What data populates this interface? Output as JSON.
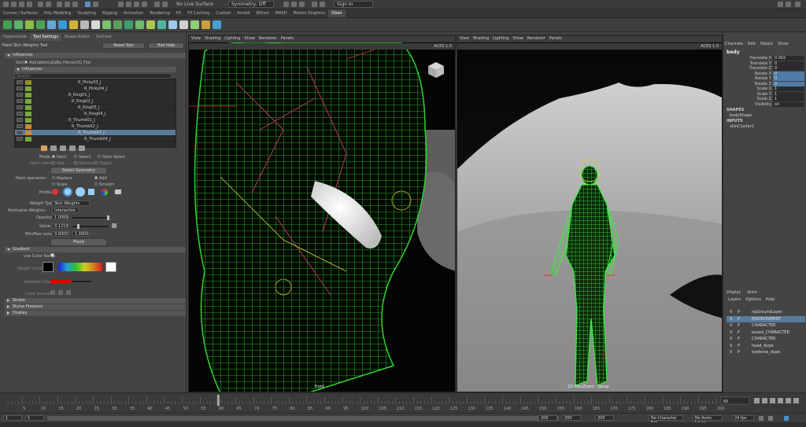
{
  "top": {
    "live_surface": "No Live Surface",
    "symmetry": "Symmetry: Off",
    "sign_in": "Sign In"
  },
  "shelf_tabs": [
    "Curves / Surfaces",
    "Poly Modeling",
    "Sculpting",
    "Rigging",
    "Animation",
    "Rendering",
    "FX",
    "FX Caching",
    "Custom",
    "Arnold",
    "Bifrost",
    "MASH",
    "Motion Graphics",
    "XGen"
  ],
  "shelf_colors": [
    "#3fa34d",
    "#59b36b",
    "#8bbf45",
    "#4aa657",
    "#63a8d6",
    "#3a9ad9",
    "#d6b13a",
    "#b9b9b9",
    "#d9d9d9",
    "#79c36a",
    "#5ba05d",
    "#3f9d6b",
    "#6db86b",
    "#a8c94f",
    "#50b6a1",
    "#9ec9e8",
    "#d0d0d0",
    "#8fcf75",
    "#c7a03a",
    "#46a0d6"
  ],
  "left_panel": {
    "tabs": [
      "Hypershade",
      "Tool Settings",
      "Shape Editor",
      "Outliner"
    ],
    "tool_name": "Paint Skin Weights Tool",
    "reset_tool": "Reset Tool",
    "tool_help": "Tool Help",
    "influences_header": "Influences",
    "sort_label": "Sort:",
    "sort_options": [
      "Alphabetically",
      "By Hierarchy",
      "Flat"
    ],
    "influences_subheader": "Influences",
    "search_placeholder": "Search",
    "joints": [
      {
        "name": "R_Pinky03_J",
        "color": "#8f8f2a",
        "indent": 80
      },
      {
        "name": "R_Pinky04_J",
        "color": "#7aa63c",
        "indent": 88
      },
      {
        "name": "R_Ring01_J",
        "color": "#7aa63c",
        "indent": 68
      },
      {
        "name": "R_Ring02_J",
        "color": "#7aa63c",
        "indent": 72
      },
      {
        "name": "R_Ring03_J",
        "color": "#7aa63c",
        "indent": 80
      },
      {
        "name": "R_Ring04_J",
        "color": "#7aa63c",
        "indent": 88
      },
      {
        "name": "R_Thumb01_J",
        "color": "#7aa63c",
        "indent": 68
      },
      {
        "name": "R_Thumb02_J",
        "color": "#c98a3a",
        "indent": 72
      },
      {
        "name": "R_Thumb03_J",
        "color": "#c98a3a",
        "indent": 80,
        "selected": true
      },
      {
        "name": "R_Thumb04_J",
        "color": "#7aa63c",
        "indent": 88
      }
    ],
    "mode_label": "Mode:",
    "mode_options": [
      "Paint",
      "Select",
      "Paint Select"
    ],
    "paint_select_label": "Paint select:",
    "paint_select_options": [
      "Add",
      "Remove",
      "Toggle"
    ],
    "select_geometry": "Select Geometry",
    "paint_operation_label": "Paint operation:",
    "paint_operation_options": [
      "Replace",
      "Add",
      "Scale",
      "Smooth"
    ],
    "profile_label": "Profile:",
    "weight_type_label": "Weight Type:",
    "weight_type_value": "Skin Weights",
    "normalize_label": "Normalize Weights:",
    "normalize_value": "Interactive",
    "opacity_label": "Opacity:",
    "opacity_value": "1.0000",
    "value_label": "Value:",
    "value_value": "0.1210",
    "minmax_label": "Min/Max value:",
    "min_value": "0.0000",
    "max_value": "1.0000",
    "flood": "Flood",
    "gradient_header": "Gradient",
    "use_color_ramp": "Use Color Ramp",
    "weight_colors_label": "Weight Colors:",
    "selected_color_label": "Selected Color:",
    "color_presets_label": "Color presets:",
    "stroke": "Stroke",
    "stylus_pressure": "Stylus Pressure",
    "display": "Display"
  },
  "viewport_left": {
    "menu": [
      "View",
      "Shading",
      "Lighting",
      "Show",
      "Renderer",
      "Panels"
    ],
    "label": "front",
    "aces": "ACES 1.0"
  },
  "viewport_right": {
    "menu": [
      "View",
      "Shading",
      "Lighting",
      "Show",
      "Renderer",
      "Panels"
    ],
    "label": "2D Pan/Zoom : persp",
    "aces": "ACES 1.0"
  },
  "right_panel": {
    "tabs": [
      "Channels",
      "Edit",
      "Object",
      "Show"
    ],
    "object": "body",
    "channels": [
      {
        "name": "Translate X",
        "value": "0.002",
        "blue": false
      },
      {
        "name": "Translate Y",
        "value": "0",
        "blue": false
      },
      {
        "name": "Translate Z",
        "value": "0",
        "blue": false
      },
      {
        "name": "Rotate X",
        "value": "0",
        "blue": true
      },
      {
        "name": "Rotate Y",
        "value": "0",
        "blue": true
      },
      {
        "name": "Rotate Z",
        "value": "0",
        "blue": true
      },
      {
        "name": "Scale X",
        "value": "1",
        "blue": false
      },
      {
        "name": "Scale Y",
        "value": "1",
        "blue": false
      },
      {
        "name": "Scale Z",
        "value": "1",
        "blue": false
      },
      {
        "name": "Visibility",
        "value": "on",
        "blue": false
      }
    ],
    "shapes_label": "SHAPES",
    "shape": "bodyShape",
    "inputs_label": "INPUTS",
    "input": "skinCluster1",
    "layer_tabs": [
      "Display",
      "Anim"
    ],
    "layer_menu": [
      "Layers",
      "Options",
      "Help"
    ],
    "layers": [
      {
        "name": "ngGroundLayer",
        "selected": false
      },
      {
        "name": "ENVIRONMENT",
        "selected": true
      },
      {
        "name": "CHARACTER",
        "selected": false
      },
      {
        "name": "posed_CHARACTER",
        "selected": false
      },
      {
        "name": "CHARACTER",
        "selected": false
      },
      {
        "name": "head_dupe",
        "selected": false
      },
      {
        "name": "eyebrow_dupe",
        "selected": false
      }
    ]
  },
  "timeline": {
    "ticks": [
      "5",
      "10",
      "15",
      "20",
      "25",
      "30",
      "35",
      "40",
      "45",
      "50",
      "55",
      "60",
      "65",
      "70",
      "75",
      "80",
      "85",
      "90",
      "95",
      "100",
      "105",
      "110",
      "115",
      "120",
      "125",
      "130",
      "135",
      "140",
      "145",
      "150",
      "155",
      "160",
      "165",
      "170",
      "175",
      "180",
      "185",
      "190",
      "195",
      "200"
    ],
    "current_frame": "60"
  },
  "range": {
    "start": "1",
    "start2": "1",
    "end": "200",
    "end2": "200",
    "end3": "200",
    "character_set": "No Character Set",
    "anim_layer": "No Anim Layer",
    "fps": "24 fps"
  }
}
